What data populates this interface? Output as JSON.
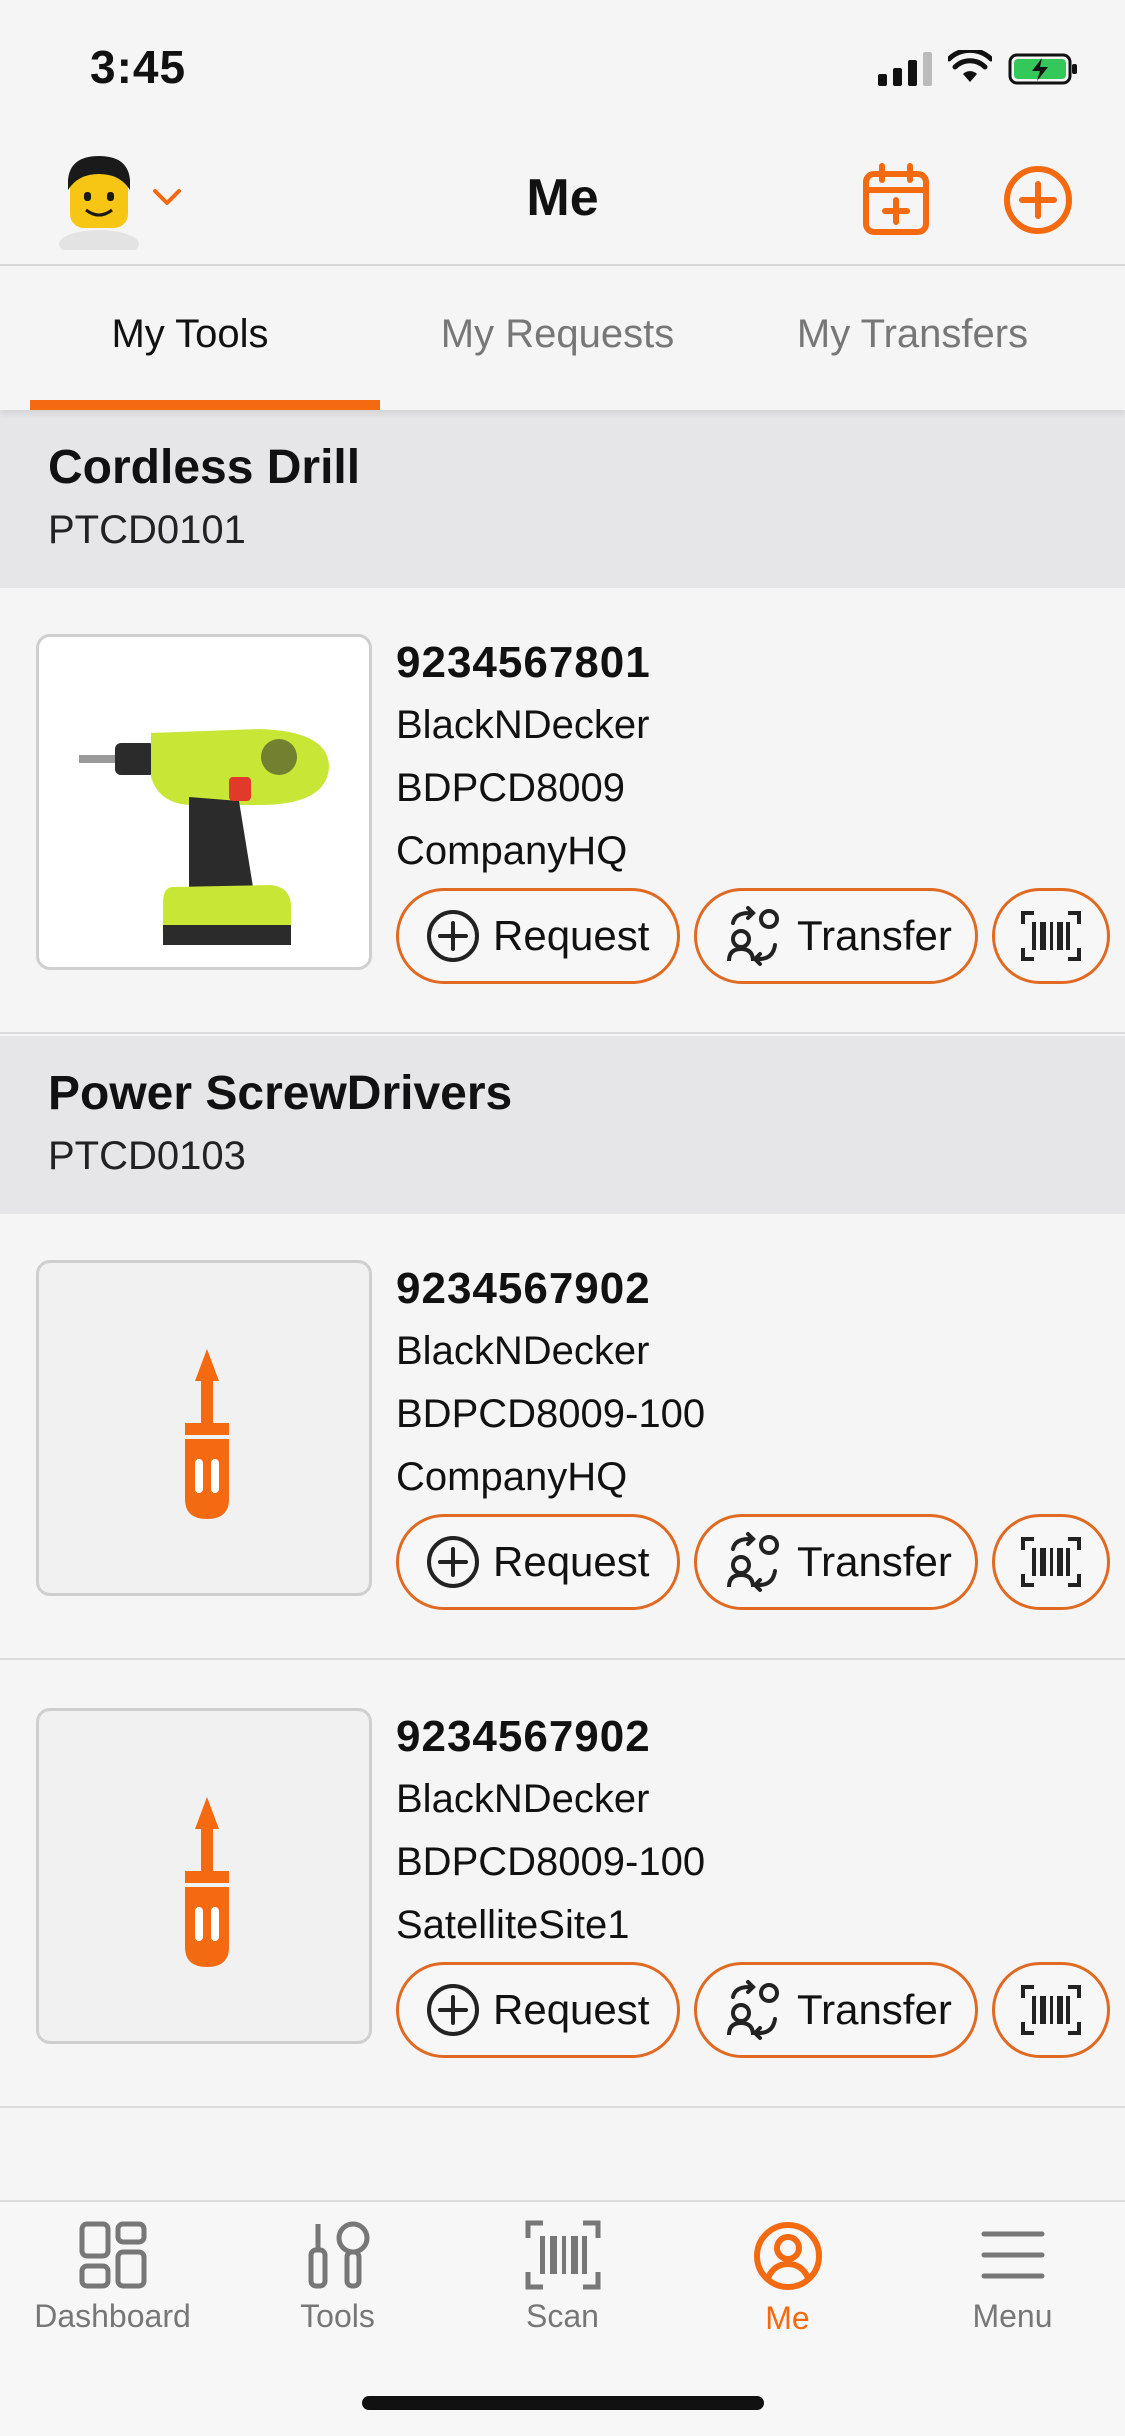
{
  "status_bar": {
    "time": "3:45"
  },
  "header": {
    "title": "Me",
    "icons": [
      "avatar",
      "chevron-down-icon",
      "calendar-add-icon",
      "add-circle-icon"
    ]
  },
  "tabs": [
    {
      "label": "My Tools",
      "active": true
    },
    {
      "label": "My Requests",
      "active": false
    },
    {
      "label": "My Transfers",
      "active": false
    }
  ],
  "groups": [
    {
      "name": "Cordless Drill",
      "code": "PTCD0101",
      "items": [
        {
          "serial": "9234567801",
          "brand": "BlackNDecker",
          "model": "BDPCD8009",
          "location": "CompanyHQ",
          "image": "drill-photo"
        }
      ]
    },
    {
      "name": "Power ScrewDrivers",
      "code": "PTCD0103",
      "items": [
        {
          "serial": "9234567902",
          "brand": "BlackNDecker",
          "model": "BDPCD8009-100",
          "location": "CompanyHQ",
          "image": "screwdriver-icon"
        },
        {
          "serial": "9234567902",
          "brand": "BlackNDecker",
          "model": "BDPCD8009-100",
          "location": "SatelliteSite1",
          "image": "screwdriver-icon"
        }
      ]
    }
  ],
  "actions": {
    "request_label": "Request",
    "transfer_label": "Transfer"
  },
  "bottom_nav": [
    {
      "label": "Dashboard",
      "icon": "dashboard-icon",
      "active": false
    },
    {
      "label": "Tools",
      "icon": "tools-icon",
      "active": false
    },
    {
      "label": "Scan",
      "icon": "barcode-icon",
      "active": false
    },
    {
      "label": "Me",
      "icon": "user-circle-icon",
      "active": true
    },
    {
      "label": "Menu",
      "icon": "menu-icon",
      "active": false
    }
  ],
  "colors": {
    "accent": "#f36a10",
    "group_bg": "#e6e6e8",
    "page_bg": "#f5f5f5"
  }
}
